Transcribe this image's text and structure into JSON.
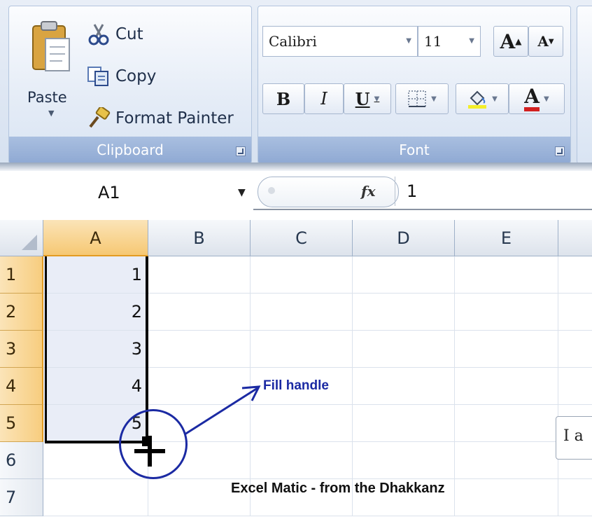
{
  "ribbon": {
    "clipboard": {
      "group_label": "Clipboard",
      "paste_label": "Paste",
      "cut_label": "Cut",
      "copy_label": "Copy",
      "format_painter_label": "Format Painter"
    },
    "font": {
      "group_label": "Font",
      "font_name": "Calibri",
      "font_size": "11",
      "bold_label": "B",
      "italic_label": "I",
      "underline_label": "U",
      "font_color_label": "A",
      "grow_label": "A",
      "shrink_label": "A"
    }
  },
  "formula_bar": {
    "name_box": "A1",
    "fx_label": "fx",
    "value": "1"
  },
  "grid": {
    "columns": [
      "A",
      "B",
      "C",
      "D",
      "E"
    ],
    "rows": [
      "1",
      "2",
      "3",
      "4",
      "5",
      "6",
      "7"
    ],
    "column_a_values": [
      "1",
      "2",
      "3",
      "4",
      "5"
    ]
  },
  "annotations": {
    "fill_handle_label": "Fill handle",
    "caption": "Excel Matic - from the Dhakkanz",
    "tooltip_fragment": "I a"
  },
  "colors": {
    "selected_header": "#f6c873",
    "annotation_blue": "#1b2aa3"
  }
}
